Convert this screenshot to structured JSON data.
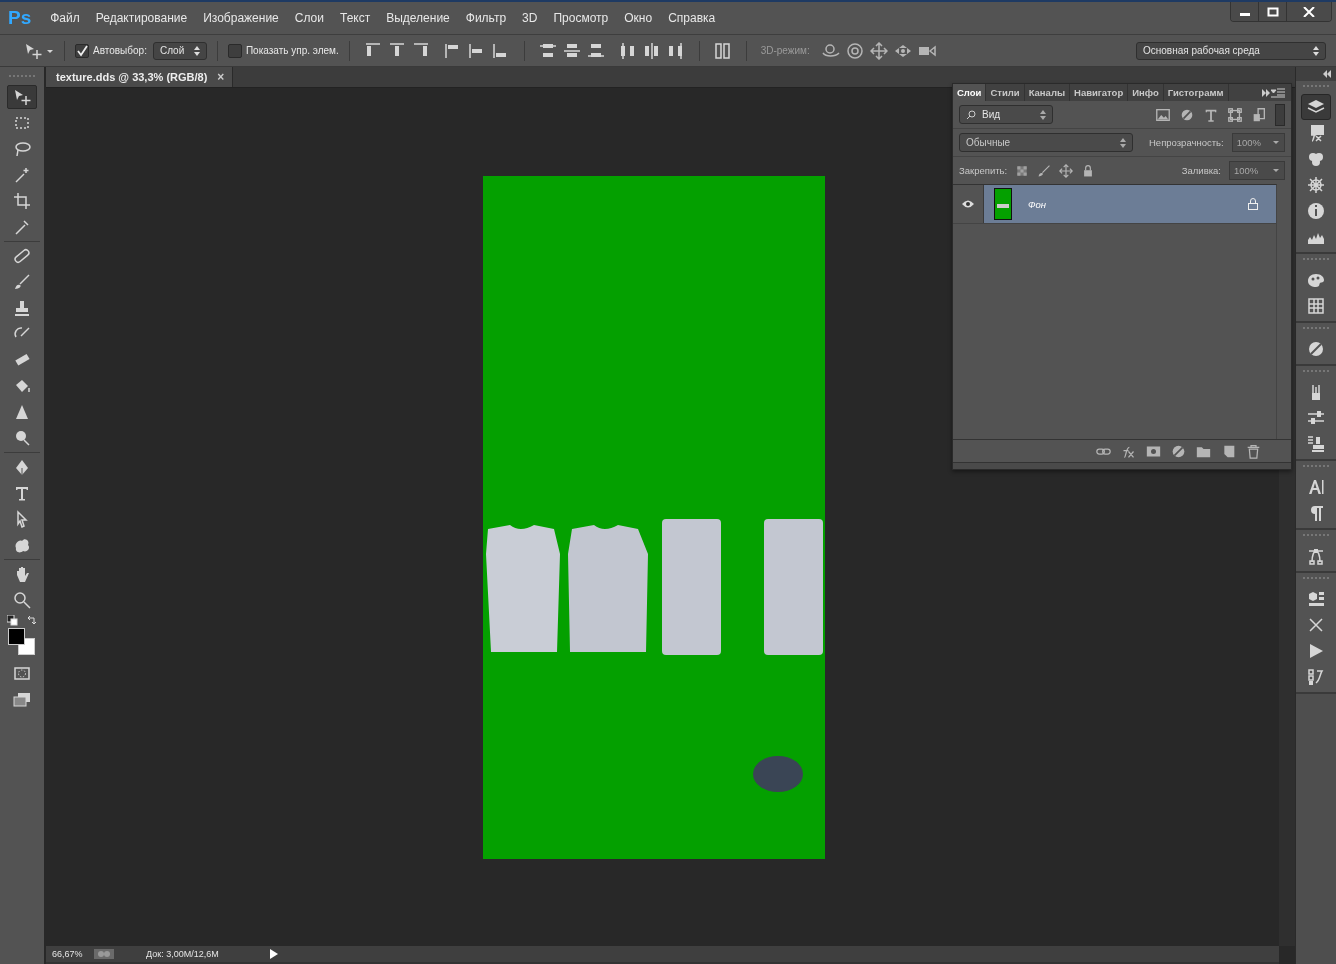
{
  "window": {
    "logo": "Ps"
  },
  "menu": [
    "Файл",
    "Редактирование",
    "Изображение",
    "Слои",
    "Текст",
    "Выделение",
    "Фильтр",
    "3D",
    "Просмотр",
    "Окно",
    "Справка"
  ],
  "options_bar": {
    "auto_select": {
      "label": "Автовыбор:",
      "checked": true
    },
    "target": "Слой",
    "show_controls": {
      "label": "Показать упр. элем.",
      "checked": false
    },
    "mode_label": "3D-режим:",
    "workspace": "Основная рабочая среда"
  },
  "tools": [
    {
      "selected": true
    },
    {
      "selected": false
    },
    {
      "selected": false
    },
    {
      "selected": false
    },
    {
      "selected": false
    },
    {
      "selected": false
    },
    {
      "selected": false
    },
    {
      "selected": false
    },
    {
      "selected": false
    },
    {
      "selected": false
    },
    {
      "selected": false
    },
    {
      "selected": false
    },
    {
      "selected": false
    },
    {
      "selected": false
    },
    {
      "selected": false
    },
    {
      "selected": false
    },
    {
      "selected": false
    },
    {
      "selected": false
    },
    {
      "selected": false
    },
    {
      "selected": false
    }
  ],
  "document_tab": {
    "title": "texture.dds @ 33,3% (RGB/8)",
    "close": "×"
  },
  "status_bar": {
    "zoom": "66,67%",
    "doc": "Док: 3,00M/12,6M"
  },
  "layers_panel": {
    "tabs": [
      {
        "label": "Слои",
        "selected": true
      },
      {
        "label": "Стили",
        "selected": false
      },
      {
        "label": "Каналы",
        "selected": false
      },
      {
        "label": "Навигатор",
        "selected": false
      },
      {
        "label": "Инфо",
        "selected": false
      },
      {
        "label": "Гистограмм",
        "selected": false
      }
    ],
    "filter": {
      "kind": "Вид"
    },
    "blend_mode": "Обычные",
    "opacity": {
      "label": "Непрозрачность:",
      "value": "100%",
      "disabled": true
    },
    "lock_label": "Закрепить:",
    "fill": {
      "label": "Заливка:",
      "value": "100%",
      "disabled": true
    },
    "layers": [
      {
        "name": "Фон",
        "visible": true,
        "locked": true,
        "selected": true
      }
    ]
  },
  "panel_dock": [
    {
      "selected": true
    },
    {
      "selected": false
    },
    {
      "selected": false
    },
    {
      "selected": false
    },
    {
      "selected": false
    },
    {
      "selected": false
    },
    {
      "selected": false
    },
    {
      "selected": false
    },
    {
      "selected": false
    },
    {
      "selected": false
    },
    {
      "selected": false
    },
    {
      "selected": false
    },
    {
      "selected": false
    },
    {
      "selected": false
    },
    {
      "selected": false
    },
    {
      "selected": false
    },
    {
      "selected": false
    },
    {
      "selected": false
    },
    {
      "selected": false
    }
  ]
}
